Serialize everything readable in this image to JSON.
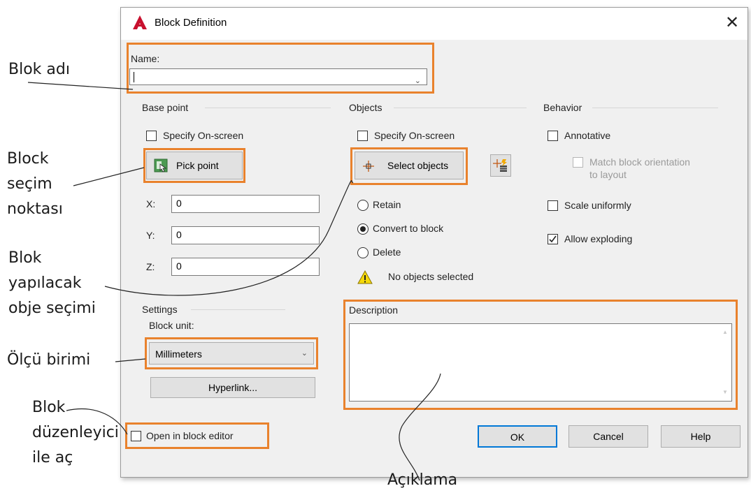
{
  "annotations": {
    "blok_adi": "Blok adı",
    "block_secim": [
      "Block",
      "seçim",
      "noktası"
    ],
    "obje_secimi": [
      "Blok",
      "yapılacak",
      "obje seçimi"
    ],
    "olcu_birimi": "Ölçü birimi",
    "blok_duzenleyici": [
      "Blok",
      "düzenleyici",
      "ile aç"
    ],
    "aciklama": "Açıklama"
  },
  "dialog": {
    "title": "Block Definition",
    "close_glyph": "✕",
    "name_label": "Name:",
    "name_value": "",
    "base_point": {
      "heading": "Base point",
      "specify_onscreen": "Specify On-screen",
      "pick_point": "Pick point",
      "x_label": "X:",
      "x_value": "0",
      "y_label": "Y:",
      "y_value": "0",
      "z_label": "Z:",
      "z_value": "0"
    },
    "objects": {
      "heading": "Objects",
      "specify_onscreen": "Specify On-screen",
      "select_objects": "Select objects",
      "retain": "Retain",
      "convert": "Convert to block",
      "delete": "Delete",
      "selected_option": "convert",
      "status": "No objects selected"
    },
    "behavior": {
      "heading": "Behavior",
      "annotative": "Annotative",
      "annotative_checked": false,
      "match_orientation": [
        "Match block orientation",
        "to layout"
      ],
      "scale_uniformly": "Scale uniformly",
      "scale_checked": false,
      "allow_exploding": "Allow exploding",
      "exploding_checked": true
    },
    "settings": {
      "heading": "Settings",
      "block_unit_label": "Block unit:",
      "block_unit_value": "Millimeters",
      "hyperlink": "Hyperlink..."
    },
    "description": {
      "heading": "Description",
      "value": ""
    },
    "open_in_editor": "Open in block editor",
    "buttons": {
      "ok": "OK",
      "cancel": "Cancel",
      "help": "Help"
    }
  },
  "colors": {
    "highlight": "#e9822d",
    "ok_border": "#0078d7",
    "autocad_red": "#c8102e"
  }
}
